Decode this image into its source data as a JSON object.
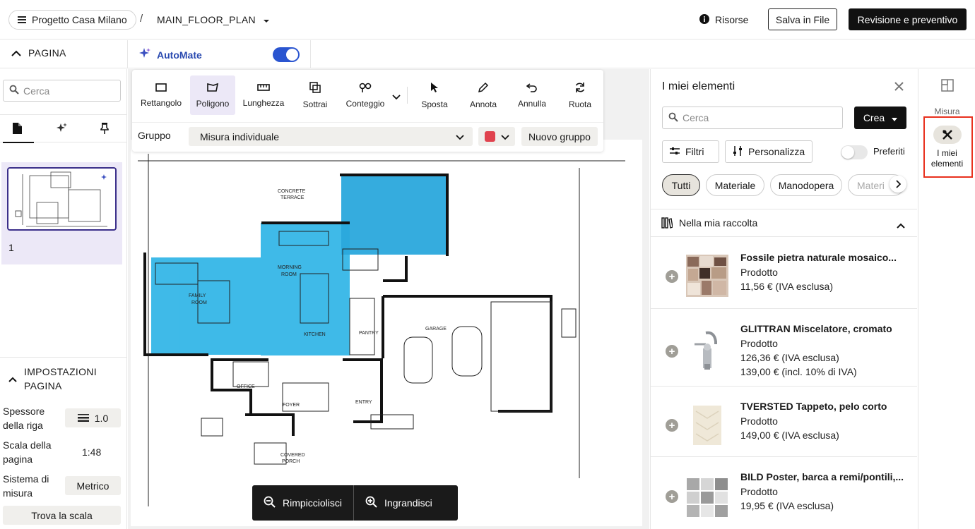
{
  "header": {
    "project": "Progetto Casa Milano",
    "separator": "/",
    "plan_name": "MAIN_FLOOR_PLAN",
    "resources": "Risorse",
    "save": "Salva in File",
    "review": "Revisione e preventivo"
  },
  "page_panel": {
    "title": "PAGINA",
    "search_placeholder": "Cerca",
    "page_number": "1",
    "settings_title_1": "IMPOSTAZIONI",
    "settings_title_2": "PAGINA",
    "line_thickness_label_1": "Spessore",
    "line_thickness_label_2": "della riga",
    "line_thickness_value": "1.0",
    "scale_label_1": "Scala della",
    "scale_label_2": "pagina",
    "scale_value": "1:48",
    "measure_label_1": "Sistema di",
    "measure_label_2": "misura",
    "measure_value": "Metrico",
    "find_scale": "Trova la scala"
  },
  "automate": {
    "label": "AutoMate",
    "enabled": true
  },
  "toolbar": {
    "tools": [
      "Rettangolo",
      "Poligono",
      "Lunghezza",
      "Sottrai",
      "Conteggio",
      "Sposta",
      "Annota",
      "Annulla",
      "Ruota"
    ],
    "active_tool": "Poligono",
    "group_label": "Gruppo",
    "group_value": "Misura individuale",
    "group_color": "#e0424e",
    "new_group": "Nuovo gruppo"
  },
  "zoom": {
    "zoom_out": "Rimpicciolisci",
    "zoom_in": "Ingrandisci"
  },
  "floorplan_labels": {
    "family_room": "FAMILY\nROOM",
    "morning_room": "MORNING\nROOM",
    "kitchen": "KITCHEN",
    "garage": "GARAGE",
    "office": "OFFICE",
    "foyer": "FOYER",
    "entry": "ENTRY",
    "porch": "COVERED\nPORCH",
    "concrete": "CONCRETE\nTERRACE",
    "pantry": "PANTRY",
    "highlight_color": "#2ab3e6"
  },
  "elements_panel": {
    "title": "I miei elementi",
    "search_placeholder": "Cerca",
    "create": "Crea",
    "filters": "Filtri",
    "customize": "Personalizza",
    "favorites": "Preferiti",
    "chips": [
      "Tutti",
      "Materiale",
      "Manodopera",
      "Materi"
    ],
    "collection": "Nella mia raccolta",
    "products": [
      {
        "name": "Fossile pietra naturale mosaico...",
        "type": "Prodotto",
        "price": "11,56 € (IVA esclusa)",
        "price2": ""
      },
      {
        "name": "GLITTRAN Miscelatore, cromato",
        "type": "Prodotto",
        "price": "126,36 € (IVA esclusa)",
        "price2": "139,00 € (incl. 10% di IVA)"
      },
      {
        "name": "TVERSTED Tappeto, pelo corto",
        "type": "Prodotto",
        "price": "149,00 € (IVA esclusa)",
        "price2": ""
      },
      {
        "name": "BILD Poster, barca a remi/pontili,...",
        "type": "Prodotto",
        "price": "19,95 € (IVA esclusa)",
        "price2": ""
      }
    ]
  },
  "rail": {
    "measure": "Misura",
    "my_items_1": "I miei",
    "my_items_2": "elementi"
  }
}
